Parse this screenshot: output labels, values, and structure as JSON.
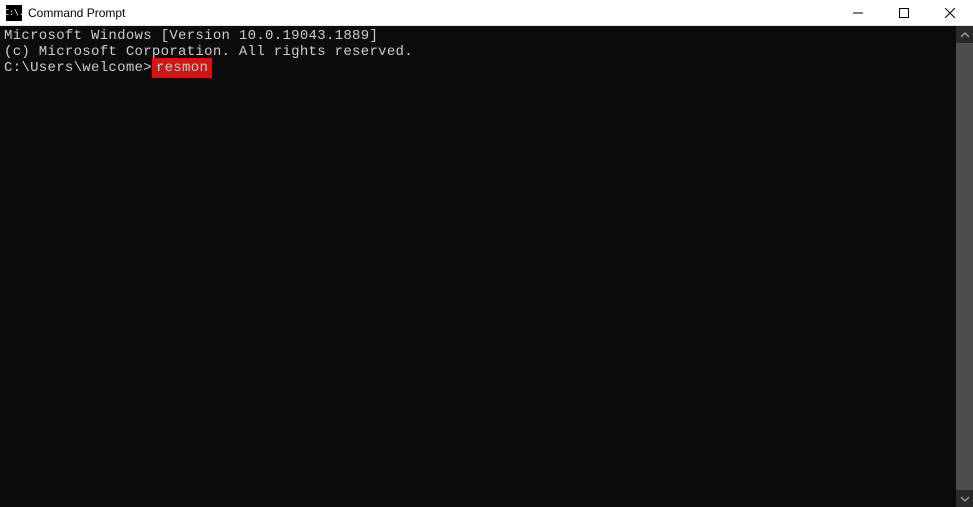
{
  "window": {
    "title": "Command Prompt",
    "app_icon_text": "C:\\."
  },
  "terminal": {
    "line1": "Microsoft Windows [Version 10.0.19043.1889]",
    "line2": "(c) Microsoft Corporation. All rights reserved.",
    "blank": "",
    "prompt": "C:\\Users\\welcome>",
    "command": "resmon"
  },
  "highlight_color": "#ff0000"
}
